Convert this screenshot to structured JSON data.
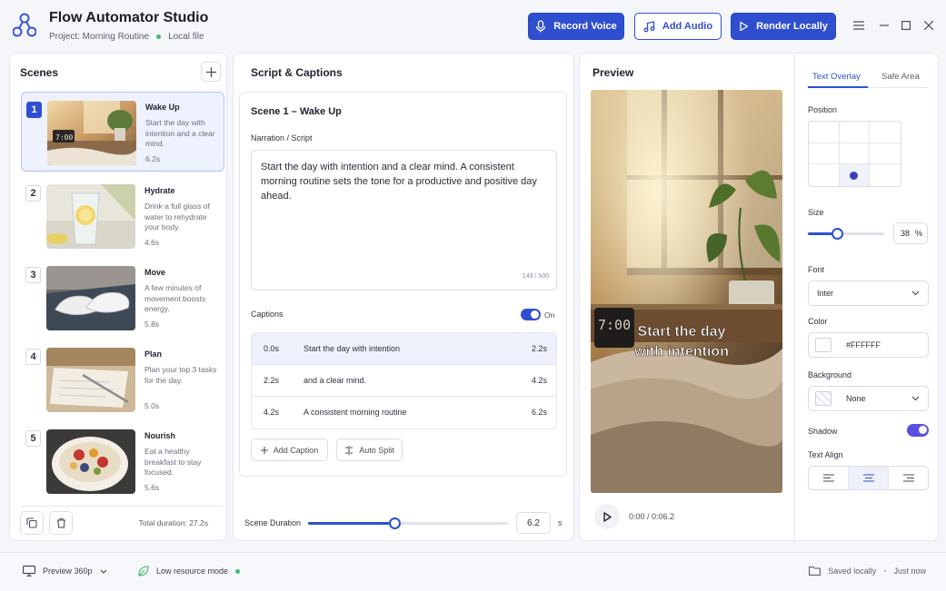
{
  "app": {
    "title": "Flow Automator Studio",
    "project": "Project: Morning Routine",
    "file_status": "Local file"
  },
  "toolbar": {
    "record_label": "Record Voice",
    "add_audio_label": "Add Audio",
    "render_label": "Render Locally"
  },
  "scenes": {
    "title": "Scenes",
    "items": [
      {
        "num": "1",
        "name": "Wake Up",
        "desc": "Start the day with intention and a clear mind.",
        "dur": "6.2s"
      },
      {
        "num": "2",
        "name": "Hydrate",
        "desc": "Drink a full glass of water to rehydrate your body.",
        "dur": "4.6s"
      },
      {
        "num": "3",
        "name": "Move",
        "desc": "A few minutes of movement boosts energy.",
        "dur": "5.8s"
      },
      {
        "num": "4",
        "name": "Plan",
        "desc": "Plan your top 3 tasks for the day.",
        "dur": "5.0s"
      },
      {
        "num": "5",
        "name": "Nourish",
        "desc": "Eat a healthy breakfast to stay focused.",
        "dur": "5.6s"
      }
    ],
    "total": "Total duration: 27.2s"
  },
  "script": {
    "title": "Script & Captions",
    "scene_heading": "Scene 1 – Wake Up",
    "narration_label": "Narration / Script",
    "narration_text": "Start the day with intention and a clear mind. A consistent morning routine sets the tone for a productive and positive day ahead.",
    "char_count": "143 / 500",
    "captions_label": "Captions",
    "captions_toggle": "On",
    "captions": [
      {
        "start": "0.0s",
        "text": "Start the day with intention",
        "end": "2.2s"
      },
      {
        "start": "2.2s",
        "text": "and a clear mind.",
        "end": "4.2s"
      },
      {
        "start": "4.2s",
        "text": "A consistent morning routine",
        "end": "6.2s"
      }
    ],
    "add_caption": "Add Caption",
    "auto_split": "Auto Split",
    "duration_label": "Scene Duration",
    "duration_value": "6.2",
    "duration_unit": "s",
    "duration_fraction": 0.43
  },
  "preview": {
    "title": "Preview",
    "overlay_text": "Start the day\nwith intention",
    "clock": "7:00",
    "time": "0:00 / 0:06.2"
  },
  "properties": {
    "tabs": [
      "Text Overlay",
      "Safe Area"
    ],
    "position_label": "Position",
    "size_label": "Size",
    "size_value": "38",
    "size_unit": "%",
    "size_fraction": 0.38,
    "font_label": "Font",
    "font_value": "Inter",
    "color_label": "Color",
    "color_value": "#FFFFFF",
    "background_label": "Background",
    "background_value": "None",
    "shadow_label": "Shadow",
    "align_label": "Text Align"
  },
  "footer": {
    "preview_quality": "Preview 360p",
    "resource_mode": "Low resource mode",
    "saved": "Saved locally",
    "saved_time": "Just now"
  },
  "colors": {
    "accent": "#2f4fd0",
    "toggle_purple": "#5b4fe0",
    "success": "#3dbb6a"
  }
}
